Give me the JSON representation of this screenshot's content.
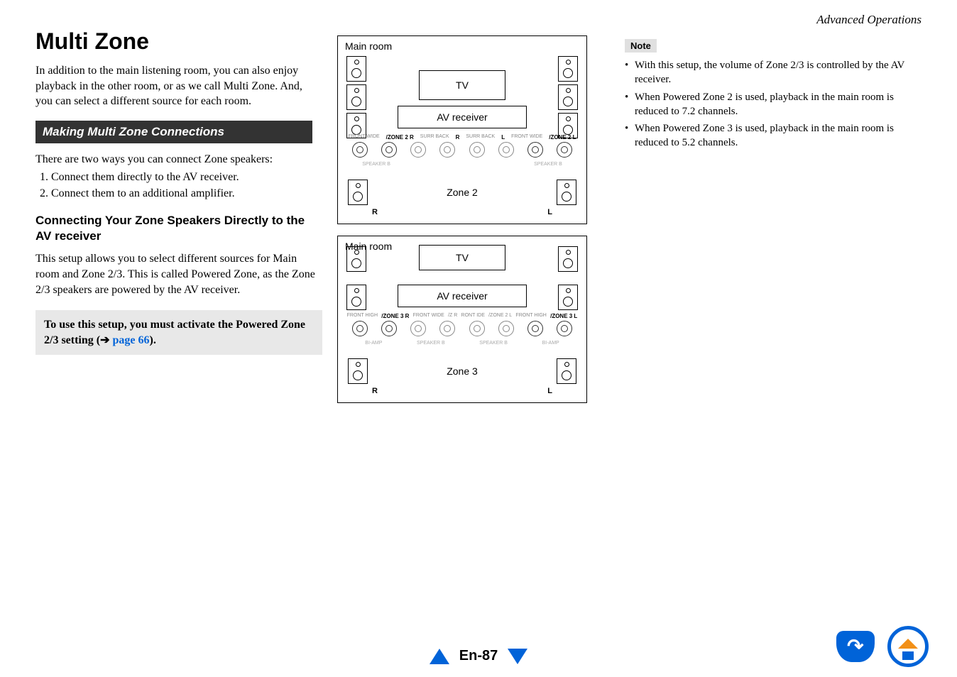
{
  "header": {
    "section_title": "Advanced Operations"
  },
  "col1": {
    "title": "Multi Zone",
    "intro": "In addition to the main listening room, you can also enjoy playback in the other room, or as we call Multi Zone. And, you can select a different source for each room.",
    "section_bar": "Making Multi Zone Connections",
    "lead": "There are two ways you can connect Zone speakers:",
    "items": [
      "Connect them directly to the AV receiver.",
      "Connect them to an additional amplifier."
    ],
    "subhead": "Connecting Your Zone Speakers Directly to the AV receiver",
    "body2": "This setup allows you to select different sources for Main room and Zone 2/3. This is called Powered Zone, as the Zone 2/3 speakers are powered by the AV receiver.",
    "callout_a": "To use this setup, you must activate the Powered Zone 2/3 setting (",
    "callout_link_arrow": "➔ ",
    "callout_link": "page 66",
    "callout_b": ")."
  },
  "diagram": {
    "main_room": "Main room",
    "tv": "TV",
    "avr": "AV receiver",
    "zone2": "Zone 2",
    "zone3": "Zone 3",
    "r": "R",
    "l": "L",
    "labels_top": {
      "front_wide": "FRONT\nWIDE",
      "zone2_r": "/ZONE 2\nR",
      "surr_back_r": "SURR\nBACK",
      "surr_back_l": "SURR\nBACK",
      "front_wide_l": "FRONT\nWIDE",
      "zone2_l": "/ZONE 2\nL",
      "r": "R",
      "l": "L"
    },
    "labels_bottom": {
      "front_high": "FRONT\nHIGH",
      "zone3_r": "/ZONE 3\nR",
      "front_wide": "FRONT\nWIDE",
      "z2r": "/Z\nR",
      "front_wide_l": "RONT\nIDE",
      "zone2_l": "/ZONE 2\nL",
      "front_high_l": "FRONT\nHIGH",
      "zone3_l": "/ZONE 3\nL",
      "biamp": "BI-AMP",
      "speaker_b": "SPEAKER B"
    },
    "mini_row_top": [
      "SPEAKER B",
      "",
      "",
      "",
      "",
      "SPEAKER B"
    ]
  },
  "notes": {
    "label": "Note",
    "items": [
      "With this setup, the volume of Zone 2/3 is controlled by the AV receiver.",
      "When Powered Zone 2 is used, playback in the main room is reduced to 7.2 channels.",
      "When Powered Zone 3 is used, playback in the main room is reduced to 5.2 channels."
    ]
  },
  "footer": {
    "page": "En-87"
  }
}
